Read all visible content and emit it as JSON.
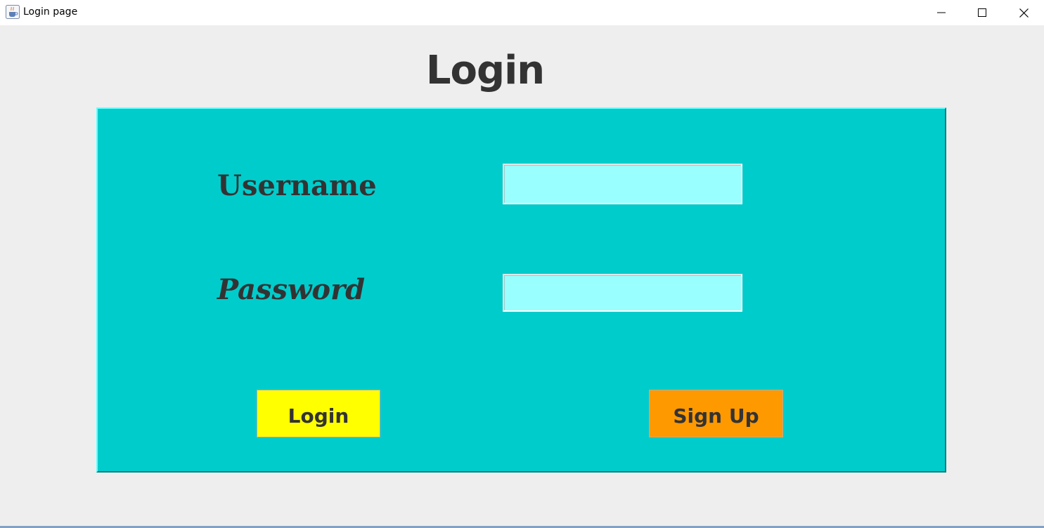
{
  "window": {
    "title": "Login page",
    "app_icon": "java-cup-icon",
    "controls": [
      "minimize-icon",
      "maximize-icon",
      "close-icon"
    ]
  },
  "page": {
    "heading": "Login"
  },
  "form": {
    "username_label": "Username",
    "username_value": "",
    "password_label": "Password",
    "password_value": ""
  },
  "buttons": {
    "login_label": "Login",
    "signup_label": "Sign Up"
  },
  "colors": {
    "background": "#eeeeee",
    "panel": "#00cccc",
    "field": "#99ffff",
    "login_button": "#ffff00",
    "signup_button": "#ff9900",
    "text": "#333333"
  }
}
